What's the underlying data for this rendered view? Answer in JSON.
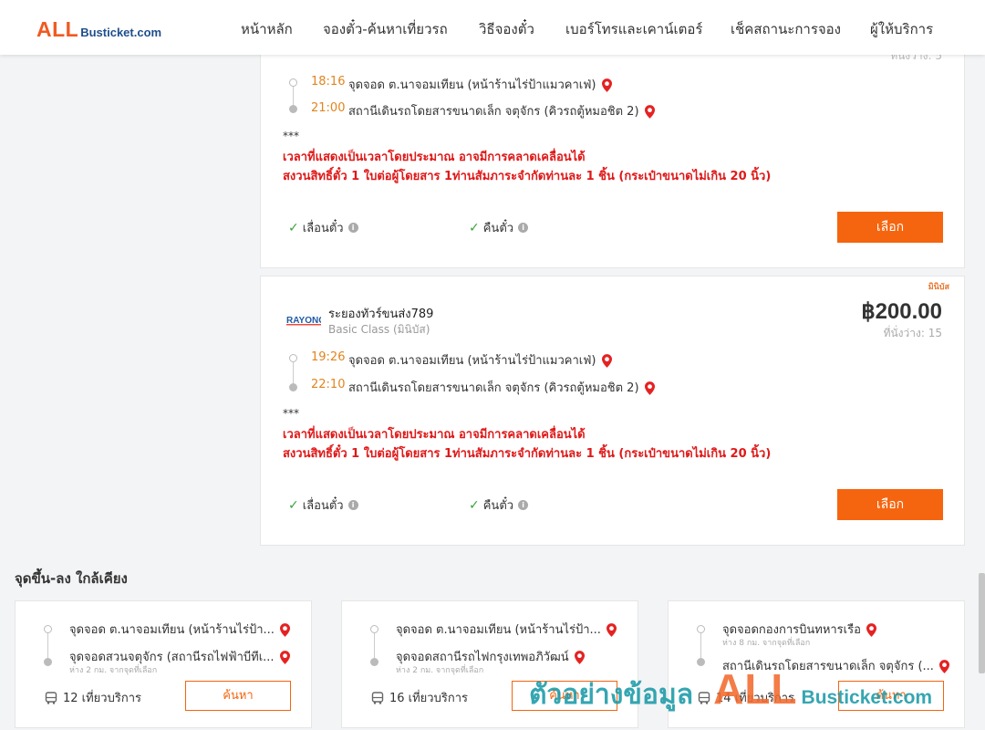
{
  "header": {
    "logo": {
      "all": "ALL",
      "rest": "Busticket.com"
    },
    "nav": [
      "หน้าหลัก",
      "จองตั๋ว-ค้นหาเที่ยวรถ",
      "วิธีจองตั๋ว",
      "เบอร์โทรและเคาน์เตอร์",
      "เช็คสถานะการจอง",
      "ผู้ให้บริการ"
    ]
  },
  "trips": [
    {
      "seats_partial": "ที่นั่งว่าง: 5",
      "departure": {
        "time": "18:16",
        "stop": "จุดจอด ต.นาจอมเทียน (หน้าร้านไร่ป้าแมวคาเฟ่)"
      },
      "arrival": {
        "time": "21:00",
        "stop": "สถานีเดินรถโดยสารขนาดเล็ก จตุจักร (คิวรถตู้หมอชิต 2)"
      },
      "note_stars": "***",
      "notes": [
        "เวลาที่แสดงเป็นเวลาโดยประมาณ อาจมีการคลาดเคลื่อนได้",
        "สงวนสิทธิ์ตั๋ว 1 ใบต่อผู้โดยสาร 1ท่านสัมภาระจำกัดท่านละ 1 ชิ้น (กระเป๋าขนาดไม่เกิน 20 นิ้ว)"
      ],
      "features": [
        "เลื่อนตั๋ว",
        "คืนตั๋ว"
      ],
      "select_label": "เลือก"
    },
    {
      "tag": "มินิบัส",
      "operator_logo": "RAYONG",
      "operator": "ระยองทัวร์ขนส่ง789",
      "class": "Basic Class (มินิบัส)",
      "price": "฿200.00",
      "seats": "ที่นั่งว่าง: 15",
      "departure": {
        "time": "19:26",
        "stop": "จุดจอด ต.นาจอมเทียน (หน้าร้านไร่ป้าแมวคาเฟ่)"
      },
      "arrival": {
        "time": "22:10",
        "stop": "สถานีเดินรถโดยสารขนาดเล็ก จตุจักร (คิวรถตู้หมอชิต 2)"
      },
      "note_stars": "***",
      "notes": [
        "เวลาที่แสดงเป็นเวลาโดยประมาณ อาจมีการคลาดเคลื่อนได้",
        "สงวนสิทธิ์ตั๋ว 1 ใบต่อผู้โดยสาร 1ท่านสัมภาระจำกัดท่านละ 1 ชิ้น (กระเป๋าขนาดไม่เกิน 20 นิ้ว)"
      ],
      "features": [
        "เลื่อนตั๋ว",
        "คืนตั๋ว"
      ],
      "select_label": "เลือก"
    }
  ],
  "nearby": {
    "title": "จุดขึ้น-ลง ใกล้เคียง",
    "cards": [
      {
        "from": "จุดจอด ต.นาจอมเทียน (หน้าร้านไร่ป้า...",
        "to": "จุดจอดสวนจตุจักร (สถานีรถไฟฟ้าบีทีเ...",
        "distance": "ห่าง 2 กม. จากจุดที่เลือก",
        "trips": "12 เที่ยวบริการ",
        "search_label": "ค้นหา"
      },
      {
        "from": "จุดจอด ต.นาจอมเทียน (หน้าร้านไร่ป้า...",
        "to": "จุดจอดสถานีรถไฟกรุงเทพอภิวัฒน์",
        "distance": "ห่าง 2 กม. จากจุดที่เลือก",
        "trips": "16 เที่ยวบริการ",
        "search_label": "ค้นหา"
      },
      {
        "from": "จุดจอดกองการบินทหารเรือ",
        "from_distance": "ห่าง 8 กม. จากจุดที่เลือก",
        "to": "สถานีเดินรถโดยสารขนาดเล็ก จตุจักร (...",
        "trips": "14 เที่ยวบริการ",
        "search_label": "ค้นหา"
      }
    ]
  },
  "watermark": {
    "thai": "ตัวอย่างข้อมูล",
    "all": "ALL",
    "rest": "Busticket.com"
  },
  "colors": {
    "accent": "#f5650f",
    "time": "#e0851f",
    "notice": "#e01818",
    "check": "#3aa33a",
    "logo_blue": "#1f4e8c"
  }
}
